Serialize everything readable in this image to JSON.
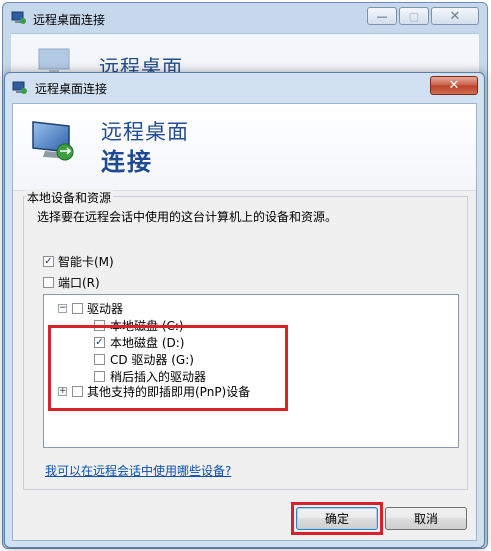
{
  "back_window": {
    "title": "远程桌面连接",
    "heading": "远程桌面",
    "controls": {
      "minimize": "—",
      "maximize": "▢",
      "close": "✕"
    }
  },
  "dialog": {
    "title": "远程桌面连接",
    "close": "✕",
    "banner": {
      "line1": "远程桌面",
      "line2": "连接"
    },
    "group": {
      "legend": "本地设备和资源",
      "description": "选择要在远程会话中使用的这台计算机上的设备和资源。"
    },
    "options": {
      "smartcard": {
        "label": "智能卡(M)",
        "checked": true
      },
      "ports": {
        "label": "端口(R)",
        "checked": false
      }
    },
    "tree": {
      "drives": {
        "label": "驱动器",
        "expander": "−",
        "checked": false,
        "children": [
          {
            "label": "本地磁盘 (C:)",
            "checked": false
          },
          {
            "label": "本地磁盘 (D:)",
            "checked": true
          },
          {
            "label": "CD 驱动器 (G:)",
            "checked": false
          },
          {
            "label": "稍后插入的驱动器",
            "checked": false
          }
        ]
      },
      "pnp": {
        "label": "其他支持的即插即用(PnP)设备",
        "expander": "+",
        "checked": false
      }
    },
    "help_link": "我可以在远程会话中使用哪些设备?",
    "buttons": {
      "ok": "确定",
      "cancel": "取消"
    },
    "highlight_color": "#d8212a"
  }
}
